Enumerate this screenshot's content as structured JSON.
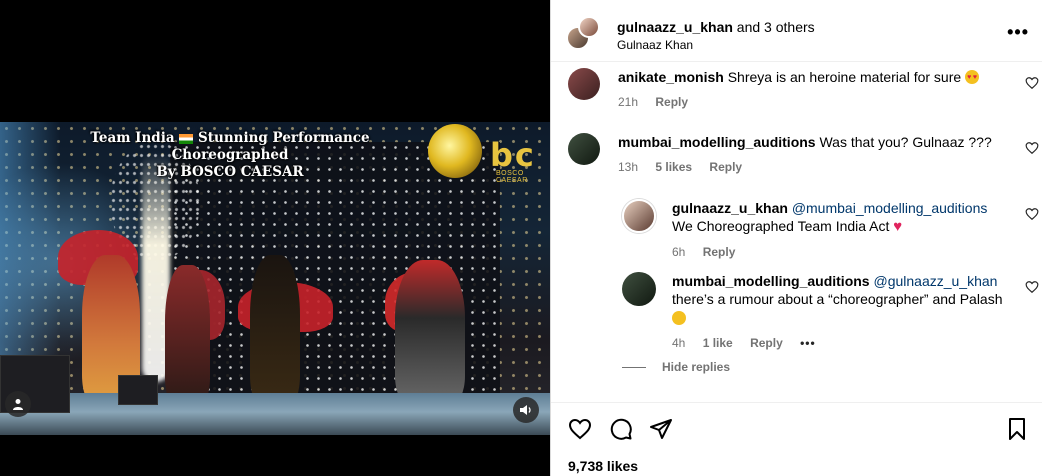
{
  "media": {
    "overlay_title_line1": "Team India",
    "overlay_title_line1b": "Stunning Performance Choreographed",
    "overlay_title_line2": "By BOSCO CAESAR",
    "logo_text": "bc",
    "logo_subtext": "BOSCO CAESAR"
  },
  "header": {
    "username": "gulnaazz_u_khan",
    "others": " and 3 others",
    "subtitle": "Gulnaaz Khan"
  },
  "comments": [
    {
      "username": "anikate_monish",
      "text": "Shreya is an heroine material for sure",
      "time": "21h",
      "reply_label": "Reply"
    },
    {
      "username": "mumbai_modelling_auditions",
      "text": "Was that you? Gulnaaz ???",
      "time": "13h",
      "likes": "5 likes",
      "reply_label": "Reply"
    }
  ],
  "replies": [
    {
      "username": "gulnaazz_u_khan",
      "mention": "@mumbai_modelling_auditions",
      "text": "We Choreographed Team India Act",
      "time": "6h",
      "reply_label": "Reply"
    },
    {
      "username": "mumbai_modelling_auditions",
      "mention": "@gulnaazz_u_khan",
      "text": "there’s a rumour about a “choreographer” and Palash",
      "time": "4h",
      "likes": "1 like",
      "reply_label": "Reply",
      "more": "•••"
    }
  ],
  "hide_replies": "Hide replies",
  "likes_count": "9,738 likes",
  "icons": {
    "like": "heart-icon",
    "comment": "comment-icon",
    "share": "share-icon",
    "save": "bookmark-icon",
    "more": "more-options-icon"
  },
  "colors": {
    "mention": "#00376b",
    "meta": "#737373",
    "heart_emoji": "#e0245e"
  }
}
